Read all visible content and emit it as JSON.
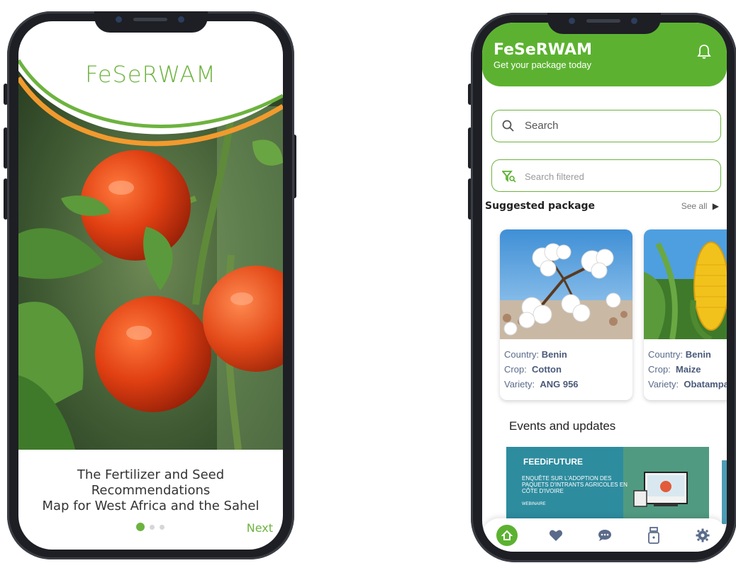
{
  "left_screen": {
    "app_title": "FeSeRWAM",
    "caption_line1": "The Fertilizer and Seed Recommendations",
    "caption_line2": "Map for West Africa and the Sahel",
    "pagination": {
      "total": 3,
      "active": 1
    },
    "next_label": "Next",
    "hero_image_icon": "tomato-plant-image"
  },
  "right_screen": {
    "header": {
      "title": "FeSeRWAM",
      "subtitle": "Get your package today",
      "bell_icon": "bell-icon"
    },
    "search": {
      "placeholder": "Search",
      "icon": "search-icon"
    },
    "search_filtered": {
      "placeholder": "Search filtered",
      "icon": "filter-search-icon"
    },
    "suggested": {
      "title": "Suggested package",
      "see_all": "See all",
      "packages": [
        {
          "country_label": "Country:",
          "country": "Benin",
          "crop_label": "Crop:",
          "crop": "Cotton",
          "variety_label": "Variety:",
          "variety": "ANG 956",
          "image": "cotton-image"
        },
        {
          "country_label": "Country:",
          "country": "Benin",
          "crop_label": "Crop:",
          "crop": "Maize",
          "variety_label": "Variety:",
          "variety": "Obatampa",
          "image": "maize-image"
        }
      ]
    },
    "events": {
      "title": "Events and updates",
      "banner_brand": "FEEDiFUTURE",
      "banner_text": "ENQUÊTE SUR L'ADOPTION DES PAQUETS D'INTRANTS AGRICOLES EN CÔTE D'IVOIRE",
      "banner_tag": "WEBINAIRE"
    },
    "bottom_nav": [
      "home-icon",
      "heart-icon",
      "chat-icon",
      "package-icon",
      "settings-icon"
    ],
    "accent_color": "#5cb230"
  }
}
